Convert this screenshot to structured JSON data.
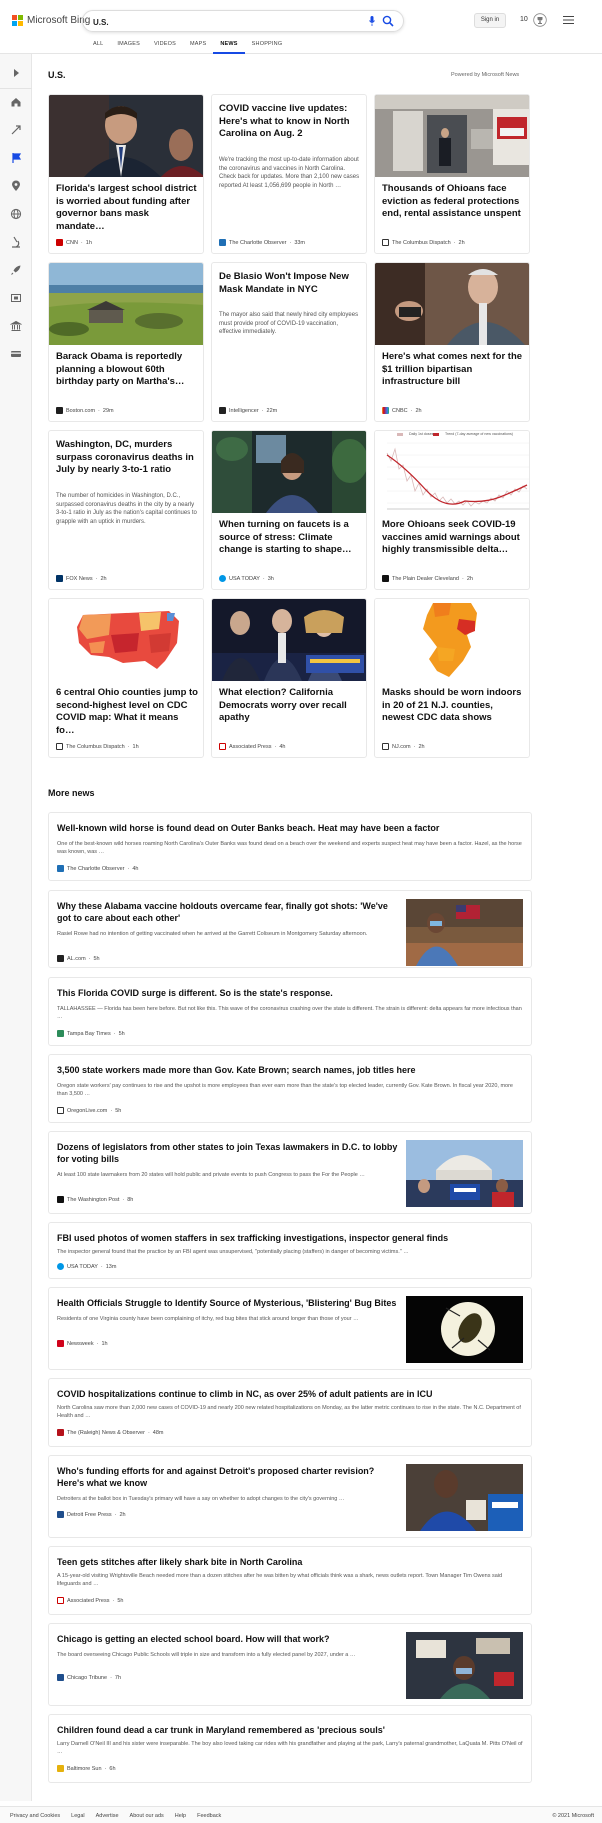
{
  "brand": {
    "name": "Microsoft Bing"
  },
  "search": {
    "query": "U.S."
  },
  "header": {
    "signin_label": "Sign in",
    "rewards_count": "10"
  },
  "scopes": [
    "ALL",
    "IMAGES",
    "VIDEOS",
    "MAPS",
    "NEWS",
    "SHOPPING"
  ],
  "section": {
    "title": "U.S.",
    "powered_by": "Powered by Microsoft News"
  },
  "cards": [
    {
      "title": "Florida's largest school district is worried about funding after governor bans mask mandate…",
      "source": "CNN",
      "time": "1h"
    },
    {
      "title": "COVID vaccine live updates: Here's what to know in North Carolina on Aug. 2",
      "snippet": "We're tracking the most up-to-date information about the coronavirus and vaccines in North Carolina. Check back for updates. More than 2,100 new cases reported At least 1,056,699 people in North …",
      "source": "The Charlotte Observer",
      "time": "33m"
    },
    {
      "title": "Thousands of Ohioans face eviction as federal protections end, rental assistance unspent",
      "source": "The Columbus Dispatch",
      "time": "2h"
    },
    {
      "title": "Barack Obama is reportedly planning a blowout 60th birthday party on Martha's…",
      "source": "Boston.com",
      "time": "29m"
    },
    {
      "title": "De Blasio Won't Impose New Mask Mandate in NYC",
      "snippet": "The mayor also said that newly hired city employees must provide proof of COVID-19 vaccination, effective immediately.",
      "source": "Intelligencer",
      "time": "22m"
    },
    {
      "title": "Here's what comes next for the $1 trillion bipartisan infrastructure bill",
      "source": "CNBC",
      "time": "2h"
    },
    {
      "title": "Washington, DC, murders surpass coronavirus deaths in July by nearly 3-to-1 ratio",
      "snippet": "The number of homicides in Washington, D.C., surpassed coronavirus deaths in the city by a nearly 3-to-1 ratio in July as the nation's capital continues to grapple with an uptick in murders.",
      "source": "FOX News",
      "time": "2h"
    },
    {
      "title": "When turning on faucets is a source of stress: Climate change is starting to shape…",
      "source": "USA TODAY",
      "time": "3h"
    },
    {
      "title": "More Ohioans seek COVID-19 vaccines amid warnings about highly transmissible delta…",
      "source": "The Plain Dealer Cleveland",
      "time": "2h",
      "chart_legend": [
        "Daily 1st doses",
        "Trend (7-day average of new vaccinations)"
      ]
    },
    {
      "title": "6 central Ohio counties jump to second-highest level on CDC COVID map: What it means fo…",
      "source": "The Columbus Dispatch",
      "time": "1h"
    },
    {
      "title": "What election? California Democrats worry over recall apathy",
      "source": "Associated Press",
      "time": "4h"
    },
    {
      "title": "Masks should be worn indoors in 20 of 21 N.J. counties, newest CDC data shows",
      "source": "NJ.com",
      "time": "2h"
    }
  ],
  "more_news": {
    "title": "More news",
    "articles": [
      {
        "title": "Well-known wild horse is found dead on Outer Banks beach. Heat may have been a factor",
        "snippet": "One of the best-known wild horses roaming North Carolina's Outer Banks was found dead on a beach over the weekend and experts suspect heat may have been a factor. Hazel, as the horse was known, was …",
        "source": "The Charlotte Observer",
        "time": "4h"
      },
      {
        "title": "Why these Alabama vaccine holdouts overcame fear, finally got shots: 'We've got to care about each other'",
        "snippet": "Rasiel Rowe had no intention of getting vaccinated when he arrived at the Garrett Coliseum in Montgomery Saturday afternoon.",
        "source": "AL.com",
        "time": "5h"
      },
      {
        "title": "This Florida COVID surge is different. So is the state's response.",
        "snippet": "TALLAHASSEE — Florida has been here before. But not like this. This wave of the coronavirus crashing over the state is different. The strain is different: delta appears far more infectious than …",
        "source": "Tampa Bay Times",
        "time": "5h"
      },
      {
        "title": "3,500 state workers made more than Gov. Kate Brown; search names, job titles here",
        "snippet": "Oregon state workers' pay continues to rise and the upshot is more employees than ever earn more than the state's top elected leader, currently Gov. Kate Brown. In fiscal year 2020, more than 3,500 …",
        "source": "OregonLive.com",
        "time": "5h"
      },
      {
        "title": "Dozens of legislators from other states to join Texas lawmakers in D.C. to lobby for voting bills",
        "snippet": "At least 100 state lawmakers from 20 states will hold public and private events to push Congress to pass the For the People …",
        "source": "The Washington Post",
        "time": "8h"
      },
      {
        "title": "FBI used photos of women staffers in sex trafficking investigations, inspector general finds",
        "snippet": "The inspector general found that the practice by an FBI agent was unsupervised, \"potentially placing (staffers) in danger of becoming victims.\" …",
        "source": "USA TODAY",
        "time": "13m"
      },
      {
        "title": "Health Officials Struggle to Identify Source of Mysterious, 'Blistering' Bug Bites",
        "snippet": "Residents of one Virginia county have been complaining of itchy, red bug bites that stick around longer than those of your …",
        "source": "Newsweek",
        "time": "1h"
      },
      {
        "title": "COVID hospitalizations continue to climb in NC, as over 25% of adult patients are in ICU",
        "snippet": "North Carolina saw more than 2,000 new cases of COVID-19 and nearly 200 new related hospitalizations on Monday, as the latter metric continues to rise in the state. The N.C. Department of Health and …",
        "source": "The (Raleigh) News & Observer",
        "time": "48m"
      },
      {
        "title": "Who's funding efforts for and against Detroit's proposed charter revision? Here's what we know",
        "snippet": "Detroiters at the ballot box in Tuesday's primary will have a say on whether to adopt changes to the city's governing …",
        "source": "Detroit Free Press",
        "time": "2h"
      },
      {
        "title": "Teen gets stitches after likely shark bite in North Carolina",
        "snippet": "A 15-year-old visiting Wrightsville Beach needed more than a dozen stitches after he was bitten by what officials think was a shark, news outlets report. Town Manager Tim Owens said lifeguards and …",
        "source": "Associated Press",
        "time": "5h"
      },
      {
        "title": "Chicago is getting an elected school board. How will that work?",
        "snippet": "The board overseeing Chicago Public Schools will triple in size and transform into a fully elected panel by 2027, under a …",
        "source": "Chicago Tribune",
        "time": "7h"
      },
      {
        "title": "Children found dead a car trunk in Maryland remembered as 'precious souls'",
        "snippet": "Larry Darnell O'Neil III and his sister were inseparable. The boy also loved taking car rides with his grandfather and playing at the park, Larry's paternal grandmother, LaQuata M. Pitts O'Neil of …",
        "source": "Baltimore Sun",
        "time": "6h"
      }
    ]
  },
  "footer": {
    "links": [
      "Privacy and Cookies",
      "Legal",
      "Advertise",
      "About our ads",
      "Help",
      "Feedback"
    ],
    "copyright": "© 2021 Microsoft"
  },
  "colors": {
    "accent": "#174ae4",
    "ms_red": "#f25022",
    "ms_green": "#7fba00",
    "ms_blue": "#00a4ef",
    "ms_yellow": "#ffb900"
  }
}
